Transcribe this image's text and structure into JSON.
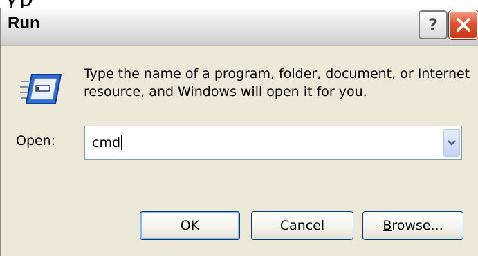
{
  "bleed_text": "yp",
  "window": {
    "title": "Run",
    "help_label": "?",
    "message": "Type the name of a program, folder, document, or Internet resource, and Windows will open it for you.",
    "open_label_accel": "O",
    "open_label_rest": "pen:",
    "open_value": "cmd",
    "buttons": {
      "ok": "OK",
      "cancel": "Cancel",
      "browse_accel": "B",
      "browse_rest": "rowse..."
    }
  },
  "icons": {
    "run": "run-program-icon",
    "help": "question-mark-icon",
    "close": "close-x-icon",
    "dropdown": "chevron-down-icon"
  },
  "colors": {
    "dialog_bg": "#ece9d8",
    "close_red": "#e2522f",
    "input_border": "#7f9db9",
    "button_border": "#003c74"
  }
}
